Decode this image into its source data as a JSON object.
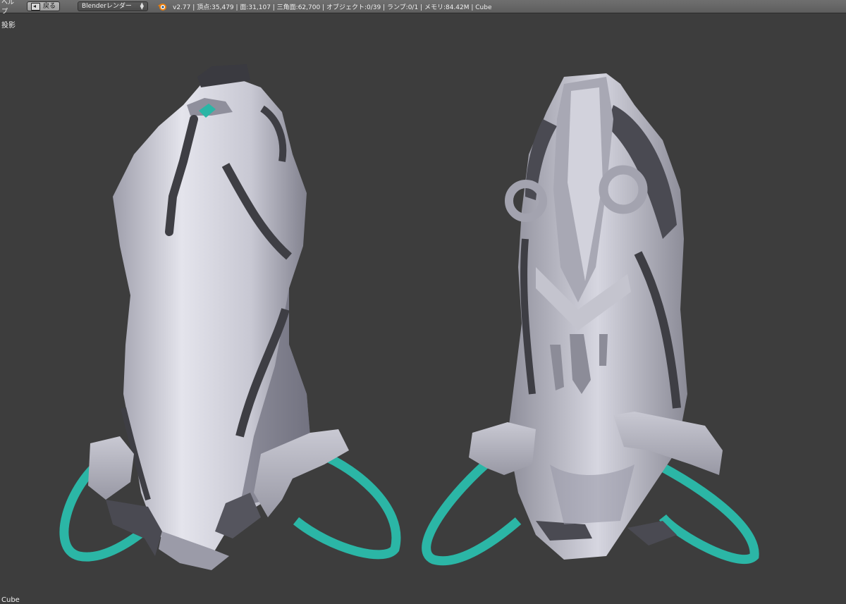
{
  "header": {
    "help_menu": "ヘルプ",
    "back_button": "戻る",
    "render_engine": "Blenderレンダー",
    "stats": "v2.77 | 頂点:35,479 | 面:31,107 | 三角面:62,700 | オブジェクト:0/39 | ランプ:0/1 | メモリ:84.42M | Cube"
  },
  "viewport": {
    "projection_label": "投影",
    "active_object": "Cube"
  },
  "colors": {
    "background": "#3d3d3d",
    "suit": "#c7c7d4",
    "trim": "#4a4a50",
    "strap": "#2bb6a6"
  }
}
